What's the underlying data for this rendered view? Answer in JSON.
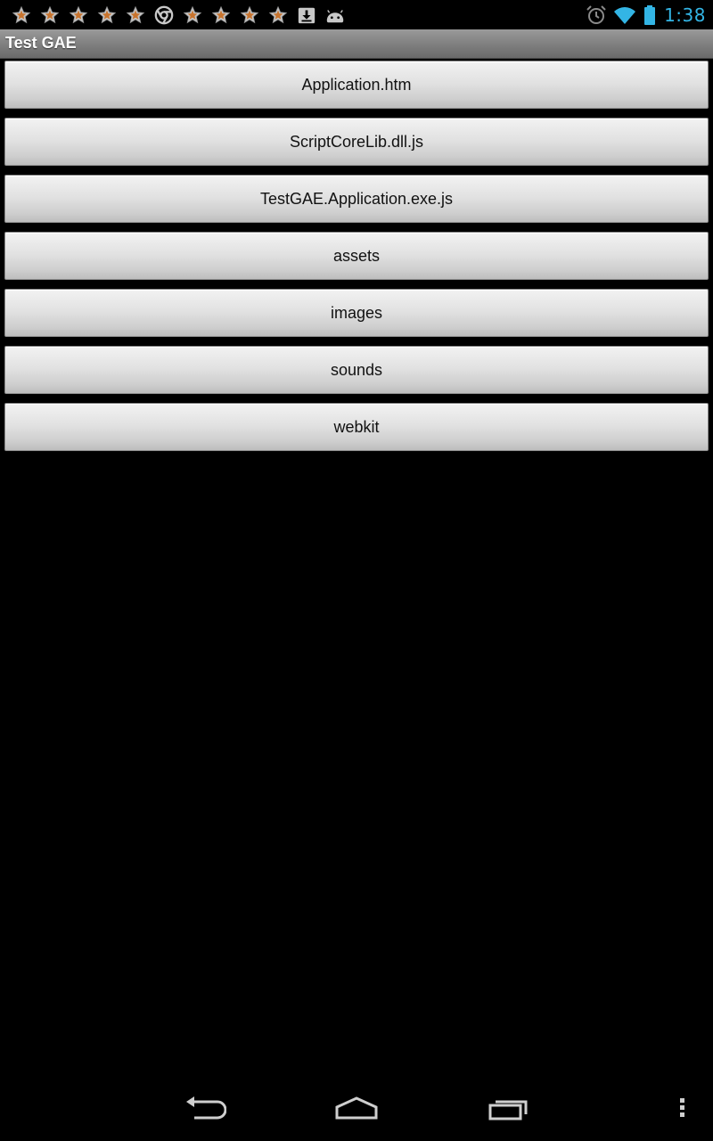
{
  "status_bar": {
    "notifications": [
      {
        "icon": "star-icon"
      },
      {
        "icon": "star-icon"
      },
      {
        "icon": "star-icon"
      },
      {
        "icon": "star-icon"
      },
      {
        "icon": "star-icon"
      },
      {
        "icon": "chrome-icon"
      },
      {
        "icon": "star-icon"
      },
      {
        "icon": "star-icon"
      },
      {
        "icon": "star-icon"
      },
      {
        "icon": "star-icon"
      },
      {
        "icon": "download-icon"
      },
      {
        "icon": "android-icon"
      }
    ],
    "alarm_icon": "alarm-icon",
    "wifi_icon": "wifi-icon",
    "battery_icon": "battery-icon",
    "time": "1:38",
    "accent_color": "#33b5e5"
  },
  "title_bar": {
    "title": "Test GAE"
  },
  "file_list": {
    "items": [
      {
        "label": "Application.htm"
      },
      {
        "label": "ScriptCoreLib.dll.js"
      },
      {
        "label": "TestGAE.Application.exe.js"
      },
      {
        "label": "assets"
      },
      {
        "label": "images"
      },
      {
        "label": "sounds"
      },
      {
        "label": "webkit"
      }
    ]
  },
  "nav_bar": {
    "back_icon": "back-icon",
    "home_icon": "home-icon",
    "recent_icon": "recent-apps-icon",
    "menu_icon": "overflow-menu-icon"
  }
}
